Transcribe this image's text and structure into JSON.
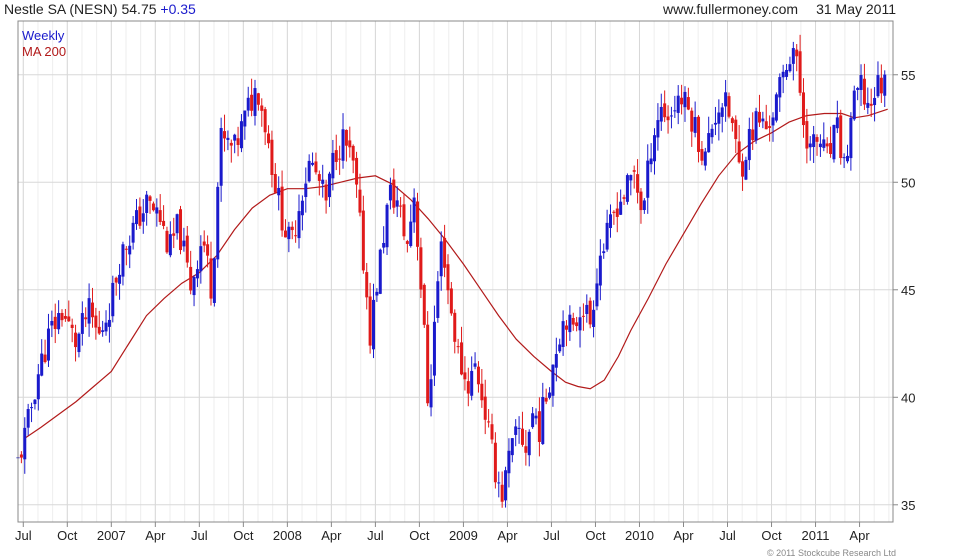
{
  "header": {
    "instrument": "Nestle SA (NESN) 54.75",
    "change": "+0.35",
    "source": "www.fullermoney.com",
    "date": "31 May 2011"
  },
  "copyright": "© 2011 Stockcube Research Ltd",
  "colors": {
    "up": "#1a1acc",
    "down": "#e01a1a",
    "ma": "#b21a1a",
    "grid": "#d8d8d8",
    "frame": "#888888"
  },
  "chart_data": {
    "type": "candlestick",
    "period": "Weekly",
    "legend": [
      {
        "name": "Weekly",
        "color": "#1a1acc"
      },
      {
        "name": "MA 200",
        "color": "#b21a1a"
      }
    ],
    "ylim": [
      34.2,
      57.5
    ],
    "y_ticks": [
      35,
      40,
      45,
      50,
      55
    ],
    "x_range": [
      2006.47,
      2011.44
    ],
    "x_ticks": [
      {
        "t": 2006.5,
        "label": "Jul"
      },
      {
        "t": 2006.75,
        "label": "Oct"
      },
      {
        "t": 2007.0,
        "label": "2007"
      },
      {
        "t": 2007.25,
        "label": "Apr"
      },
      {
        "t": 2007.5,
        "label": "Jul"
      },
      {
        "t": 2007.75,
        "label": "Oct"
      },
      {
        "t": 2008.0,
        "label": "2008"
      },
      {
        "t": 2008.25,
        "label": "Apr"
      },
      {
        "t": 2008.5,
        "label": "Jul"
      },
      {
        "t": 2008.75,
        "label": "Oct"
      },
      {
        "t": 2009.0,
        "label": "2009"
      },
      {
        "t": 2009.25,
        "label": "Apr"
      },
      {
        "t": 2009.5,
        "label": "Jul"
      },
      {
        "t": 2009.75,
        "label": "Oct"
      },
      {
        "t": 2010.0,
        "label": "2010"
      },
      {
        "t": 2010.25,
        "label": "Apr"
      },
      {
        "t": 2010.5,
        "label": "Jul"
      },
      {
        "t": 2010.75,
        "label": "Oct"
      },
      {
        "t": 2011.0,
        "label": "2011"
      },
      {
        "t": 2011.25,
        "label": "Apr"
      }
    ],
    "price_path": [
      [
        2006.47,
        37.0
      ],
      [
        2006.52,
        38.5
      ],
      [
        2006.58,
        41.0
      ],
      [
        2006.65,
        43.0
      ],
      [
        2006.72,
        44.0
      ],
      [
        2006.8,
        42.5
      ],
      [
        2006.87,
        44.0
      ],
      [
        2006.93,
        42.8
      ],
      [
        2007.0,
        44.5
      ],
      [
        2007.05,
        46.5
      ],
      [
        2007.12,
        47.8
      ],
      [
        2007.2,
        49.0
      ],
      [
        2007.27,
        48.5
      ],
      [
        2007.33,
        46.8
      ],
      [
        2007.38,
        48.0
      ],
      [
        2007.45,
        45.2
      ],
      [
        2007.52,
        47.5
      ],
      [
        2007.57,
        45.0
      ],
      [
        2007.62,
        52.0
      ],
      [
        2007.7,
        51.5
      ],
      [
        2007.78,
        53.5
      ],
      [
        2007.83,
        54.5
      ],
      [
        2007.88,
        52.5
      ],
      [
        2007.93,
        50.0
      ],
      [
        2007.98,
        48.0
      ],
      [
        2008.02,
        47.0
      ],
      [
        2008.08,
        49.5
      ],
      [
        2008.13,
        51.0
      ],
      [
        2008.18,
        50.0
      ],
      [
        2008.22,
        49.0
      ],
      [
        2008.27,
        51.5
      ],
      [
        2008.32,
        52.0
      ],
      [
        2008.38,
        50.5
      ],
      [
        2008.43,
        46.5
      ],
      [
        2008.47,
        43.0
      ],
      [
        2008.52,
        46.0
      ],
      [
        2008.58,
        49.5
      ],
      [
        2008.63,
        49.0
      ],
      [
        2008.68,
        47.0
      ],
      [
        2008.72,
        49.5
      ],
      [
        2008.77,
        44.0
      ],
      [
        2008.8,
        39.5
      ],
      [
        2008.85,
        45.0
      ],
      [
        2008.88,
        47.5
      ],
      [
        2008.92,
        44.5
      ],
      [
        2008.97,
        42.0
      ],
      [
        2009.02,
        40.5
      ],
      [
        2009.07,
        41.5
      ],
      [
        2009.12,
        39.5
      ],
      [
        2009.17,
        37.0
      ],
      [
        2009.22,
        35.5
      ],
      [
        2009.27,
        37.5
      ],
      [
        2009.32,
        38.5
      ],
      [
        2009.35,
        37.5
      ],
      [
        2009.4,
        39.5
      ],
      [
        2009.43,
        38.5
      ],
      [
        2009.48,
        40.5
      ],
      [
        2009.53,
        42.5
      ],
      [
        2009.58,
        44.0
      ],
      [
        2009.62,
        42.8
      ],
      [
        2009.67,
        44.5
      ],
      [
        2009.72,
        43.5
      ],
      [
        2009.77,
        46.5
      ],
      [
        2009.82,
        47.5
      ],
      [
        2009.87,
        49.0
      ],
      [
        2009.92,
        49.5
      ],
      [
        2009.97,
        50.5
      ],
      [
        2010.02,
        48.5
      ],
      [
        2010.07,
        52.0
      ],
      [
        2010.12,
        53.5
      ],
      [
        2010.17,
        53.0
      ],
      [
        2010.22,
        54.0
      ],
      [
        2010.27,
        53.5
      ],
      [
        2010.32,
        52.5
      ],
      [
        2010.37,
        51.0
      ],
      [
        2010.42,
        53.0
      ],
      [
        2010.47,
        53.8
      ],
      [
        2010.52,
        53.0
      ],
      [
        2010.57,
        50.5
      ],
      [
        2010.62,
        52.0
      ],
      [
        2010.67,
        53.0
      ],
      [
        2010.72,
        52.5
      ],
      [
        2010.77,
        53.5
      ],
      [
        2010.82,
        55.0
      ],
      [
        2010.87,
        56.5
      ],
      [
        2010.9,
        55.0
      ],
      [
        2010.93,
        53.0
      ],
      [
        2010.97,
        51.5
      ],
      [
        2011.02,
        52.0
      ],
      [
        2011.07,
        51.0
      ],
      [
        2011.12,
        52.5
      ],
      [
        2011.17,
        50.5
      ],
      [
        2011.2,
        53.0
      ],
      [
        2011.25,
        54.5
      ],
      [
        2011.3,
        53.5
      ],
      [
        2011.35,
        54.5
      ],
      [
        2011.41,
        54.75
      ]
    ],
    "ma200": [
      [
        2006.51,
        38.1
      ],
      [
        2006.6,
        38.6
      ],
      [
        2006.7,
        39.2
      ],
      [
        2006.8,
        39.8
      ],
      [
        2006.9,
        40.5
      ],
      [
        2007.0,
        41.2
      ],
      [
        2007.1,
        42.5
      ],
      [
        2007.2,
        43.8
      ],
      [
        2007.3,
        44.6
      ],
      [
        2007.4,
        45.3
      ],
      [
        2007.5,
        45.8
      ],
      [
        2007.6,
        46.6
      ],
      [
        2007.7,
        47.8
      ],
      [
        2007.8,
        48.8
      ],
      [
        2007.9,
        49.4
      ],
      [
        2008.0,
        49.7
      ],
      [
        2008.1,
        49.7
      ],
      [
        2008.2,
        49.8
      ],
      [
        2008.3,
        50.0
      ],
      [
        2008.4,
        50.2
      ],
      [
        2008.5,
        50.3
      ],
      [
        2008.6,
        49.9
      ],
      [
        2008.7,
        49.2
      ],
      [
        2008.8,
        48.3
      ],
      [
        2008.9,
        47.3
      ],
      [
        2009.0,
        46.2
      ],
      [
        2009.1,
        45.0
      ],
      [
        2009.2,
        43.8
      ],
      [
        2009.3,
        42.7
      ],
      [
        2009.4,
        41.9
      ],
      [
        2009.5,
        41.2
      ],
      [
        2009.58,
        40.7
      ],
      [
        2009.65,
        40.5
      ],
      [
        2009.72,
        40.4
      ],
      [
        2009.8,
        40.8
      ],
      [
        2009.88,
        41.9
      ],
      [
        2009.95,
        43.1
      ],
      [
        2010.05,
        44.6
      ],
      [
        2010.15,
        46.2
      ],
      [
        2010.25,
        47.6
      ],
      [
        2010.35,
        49.0
      ],
      [
        2010.45,
        50.3
      ],
      [
        2010.55,
        51.3
      ],
      [
        2010.65,
        51.9
      ],
      [
        2010.75,
        52.3
      ],
      [
        2010.85,
        52.8
      ],
      [
        2010.95,
        53.1
      ],
      [
        2011.05,
        53.2
      ],
      [
        2011.15,
        53.2
      ],
      [
        2011.22,
        53.0
      ],
      [
        2011.3,
        53.1
      ],
      [
        2011.41,
        53.4
      ]
    ]
  }
}
